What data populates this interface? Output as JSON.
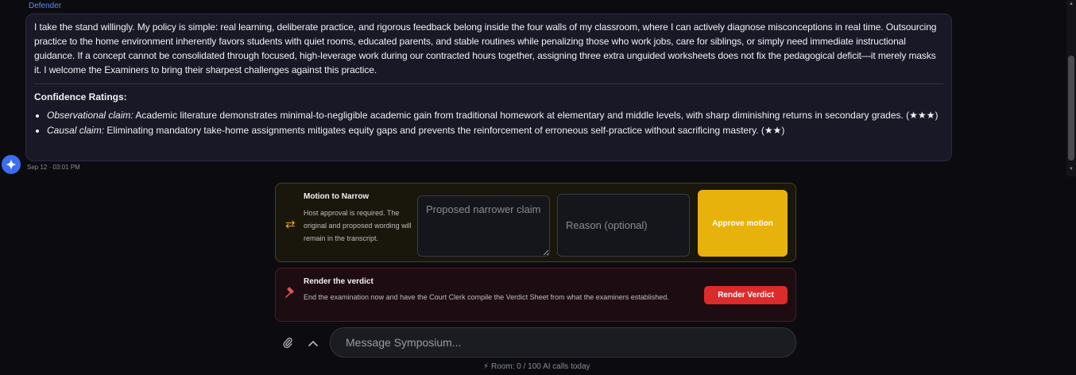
{
  "message": {
    "sender": "Defender",
    "paragraph": "I take the stand willingly. My policy is simple: real learning, deliberate practice, and rigorous feedback belong inside the four walls of my classroom, where I can actively diagnose misconceptions in real time. Outsourcing practice to the home environment inherently favors students with quiet rooms, educated parents, and stable routines while penalizing those who work jobs, care for siblings, or simply need immediate instructional guidance. If a concept cannot be consolidated through focused, high-leverage work during our contracted hours together, assigning three extra unguided worksheets does not fix the pedagogical deficit—it merely masks it. I welcome the Examiners to bring their sharpest challenges against this practice.",
    "ratings_heading": "Confidence Ratings:",
    "ratings": [
      {
        "label": "Observational claim:",
        "text": " Academic literature demonstrates minimal-to-negligible academic gain from traditional homework at elementary and middle levels, with sharp diminishing returns in secondary grades. (★★★)"
      },
      {
        "label": "Causal claim:",
        "text": " Eliminating mandatory take-home assignments mitigates equity gaps and prevents the reinforcement of erroneous self-practice without sacrificing mastery. (★★)"
      }
    ],
    "timestamp": "Sep 12 · 03:01 PM",
    "avatar_icon": "sparkle-icon"
  },
  "motion": {
    "icon": "swap-arrows-icon",
    "title": "Motion to Narrow",
    "description": "Host approval is required. The original and proposed wording will remain in the transcript.",
    "narrow_placeholder": "Proposed narrower claim",
    "reason_placeholder": "Reason (optional)",
    "approve_label": "Approve motion"
  },
  "verdict": {
    "icon": "gavel-icon",
    "title": "Render the verdict",
    "description": "End the examination now and have the Court Clerk compile the Verdict Sheet from what the examiners established.",
    "button_label": "Render Verdict"
  },
  "composer": {
    "placeholder": "Message Symposium...",
    "attach_icon": "paperclip-icon",
    "expand_icon": "chevron-up-icon"
  },
  "usage": {
    "icon": "bolt-icon",
    "text": "Room: 0 / 100 AI calls today"
  },
  "colors": {
    "accent_blue": "#3b6df2",
    "motion_yellow": "#e8b20c",
    "verdict_red": "#dc2b2b"
  }
}
